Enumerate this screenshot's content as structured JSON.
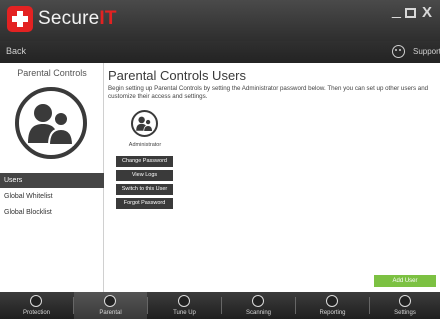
{
  "app": {
    "brand_prefix": "Secure",
    "brand_suffix": "IT",
    "brand_color": "#e32222"
  },
  "window": {
    "minimize_icon": "minimize-icon",
    "maximize_icon": "maximize-icon",
    "close_label": "X"
  },
  "subbar": {
    "back_label": "Back",
    "support_label": "Support"
  },
  "sidebar": {
    "title": "Parental Controls",
    "items": [
      {
        "label": "Users",
        "active": true
      },
      {
        "label": "Global Whitelist",
        "active": false
      },
      {
        "label": "Global Blocklist",
        "active": false
      }
    ]
  },
  "main": {
    "title": "Parental Controls Users",
    "description": "Begin setting up Parental Controls by setting the Administrator password below. Then you can set up other users and customize their access and settings.",
    "user": {
      "name": "Administrator"
    },
    "buttons": [
      "Change Password",
      "View Logs",
      "Switch to this User",
      "Forgot Password"
    ],
    "add_user_label": "Add User",
    "add_user_color": "#7cc142"
  },
  "bottom_nav": {
    "tabs": [
      {
        "label": "Protection",
        "icon": "lock-icon",
        "active": false
      },
      {
        "label": "Parental",
        "icon": "users-icon",
        "active": true
      },
      {
        "label": "Tune Up",
        "icon": "tune-up-icon",
        "active": false
      },
      {
        "label": "Scanning",
        "icon": "scan-icon",
        "active": false
      },
      {
        "label": "Reporting",
        "icon": "report-icon",
        "active": false
      },
      {
        "label": "Settings",
        "icon": "gear-icon",
        "active": false
      }
    ]
  }
}
